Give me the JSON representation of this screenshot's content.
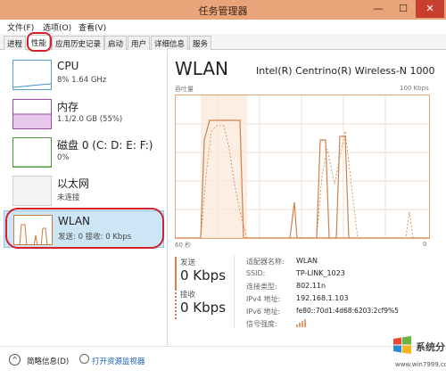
{
  "window": {
    "title": "任务管理器",
    "min": "—",
    "max": "☐",
    "close": "✕"
  },
  "menu": [
    "文件(F)",
    "选项(O)",
    "查看(V)"
  ],
  "tabs": [
    "进程",
    "性能",
    "应用历史记录",
    "启动",
    "用户",
    "详细信息",
    "服务"
  ],
  "sidebar": {
    "items": [
      {
        "name": "CPU",
        "sub": "8% 1.64 GHz"
      },
      {
        "name": "内存",
        "sub": "1.1/2.0 GB (55%)"
      },
      {
        "name": "磁盘 0 (C: D: E: F:)",
        "sub": "0%"
      },
      {
        "name": "以太网",
        "sub": "未连接"
      },
      {
        "name": "WLAN",
        "sub": "发送: 0 接收: 0 Kbps"
      }
    ]
  },
  "main": {
    "title": "WLAN",
    "device": "Intel(R) Centrino(R) Wireless-N 1000",
    "axis_left": "吞吐量",
    "axis_right": "100 Kbps",
    "axis_bottom_left": "60 秒",
    "axis_bottom_right": "0"
  },
  "stats": {
    "send_label": "发送",
    "send_value": "0 Kbps",
    "recv_label": "接收",
    "recv_value": "0 Kbps"
  },
  "properties": [
    {
      "key": "适配器名称:",
      "value": "WLAN"
    },
    {
      "key": "SSID:",
      "value": "TP-LINK_1023"
    },
    {
      "key": "连接类型:",
      "value": "802.11n"
    },
    {
      "key": "IPv4 地址:",
      "value": "192.168.1.103"
    },
    {
      "key": "IPv6 地址:",
      "value": "fe80::70d1:4d68:6203:2cf9%5"
    },
    {
      "key": "信号强度:",
      "value": ""
    }
  ],
  "bottom": {
    "summary": "简略信息(D)",
    "monitor": "打开资源监视器"
  },
  "watermark": {
    "text": "系统分",
    "url": "www.win7999.com"
  },
  "colors": {
    "accent": "#e7a673",
    "highlight": "#d4202a",
    "selected": "#cde6f5",
    "link": "#1a5fb4"
  }
}
